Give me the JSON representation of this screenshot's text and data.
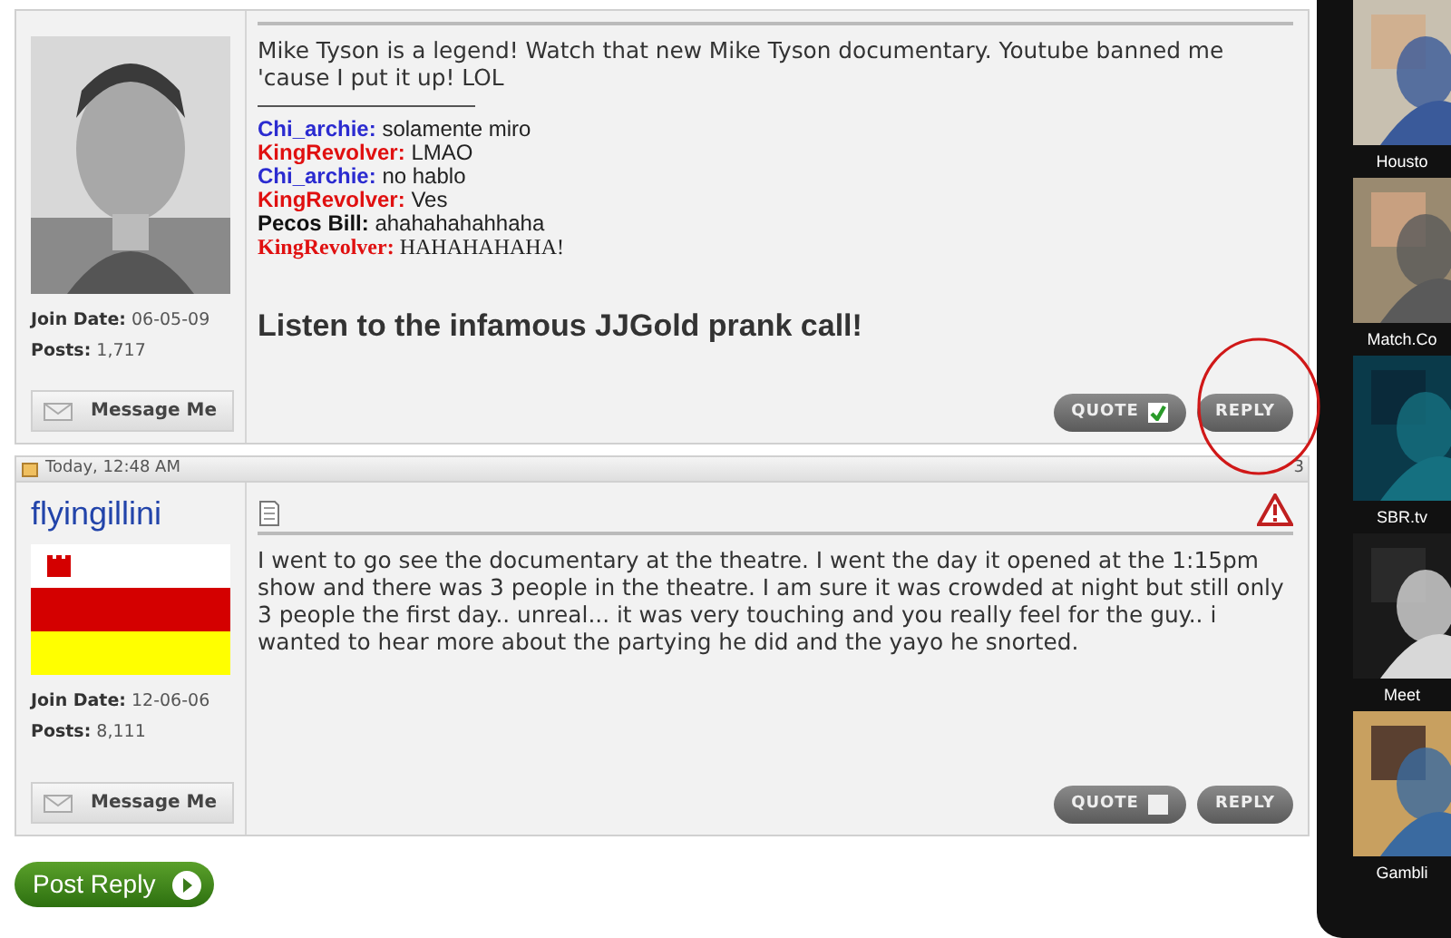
{
  "posts": [
    {
      "user": {
        "join_label": "Join Date:",
        "join_date": "06-05-09",
        "posts_label": "Posts:",
        "posts": "1,717",
        "message_button": "Message Me"
      },
      "message": "Mike Tyson is a legend! Watch that new Mike Tyson documentary. Youtube banned me 'cause I put it up! LOL",
      "signature": {
        "lines": [
          {
            "name": "Chi_archie:",
            "text": "solamente miro",
            "color": "#2b2bd0"
          },
          {
            "name": "KingRevolver:",
            "text": "LMAO",
            "color": "#e01010"
          },
          {
            "name": "Chi_archie:",
            "text": "no hablo",
            "color": "#2b2bd0"
          },
          {
            "name": "KingRevolver:",
            "text": "Ves",
            "color": "#e01010"
          },
          {
            "name": "Pecos Bill:",
            "text": "ahahahahahhaha",
            "color": "#111111"
          },
          {
            "name": "KingRevolver:",
            "text": "HAHAHAHAHA!",
            "color": "#e01010"
          }
        ],
        "link": "Listen to the infamous JJGold prank call!"
      },
      "quote_button": "QUOTE",
      "quote_checked": true,
      "reply_button": "REPLY",
      "reply_circled": true
    },
    {
      "date": "Today, 12:48 AM",
      "number": "3",
      "user": {
        "name": "flyingillini",
        "avatar": {
          "kind": "flag"
        },
        "join_label": "Join Date:",
        "join_date": "12-06-06",
        "posts_label": "Posts:",
        "posts": "8,111",
        "message_button": "Message Me"
      },
      "message": "I went to go see the documentary at the theatre. I went the day it opened at the 1:15pm show and there was 3 people in the theatre. I am sure it was crowded at night but still only 3 people the first day.. unreal... it was very touching and you really feel for the guy.. i wanted to hear more about the partying he did and the yayo he snorted.",
      "quote_button": "QUOTE",
      "quote_checked": false,
      "reply_button": "REPLY"
    }
  ],
  "post_reply_button": "Post Reply",
  "video_panel": [
    {
      "caption": "Housto"
    },
    {
      "caption": "Match.Co"
    },
    {
      "caption": "SBR.tv"
    },
    {
      "caption": "Meet"
    },
    {
      "caption": "Gambli"
    }
  ]
}
